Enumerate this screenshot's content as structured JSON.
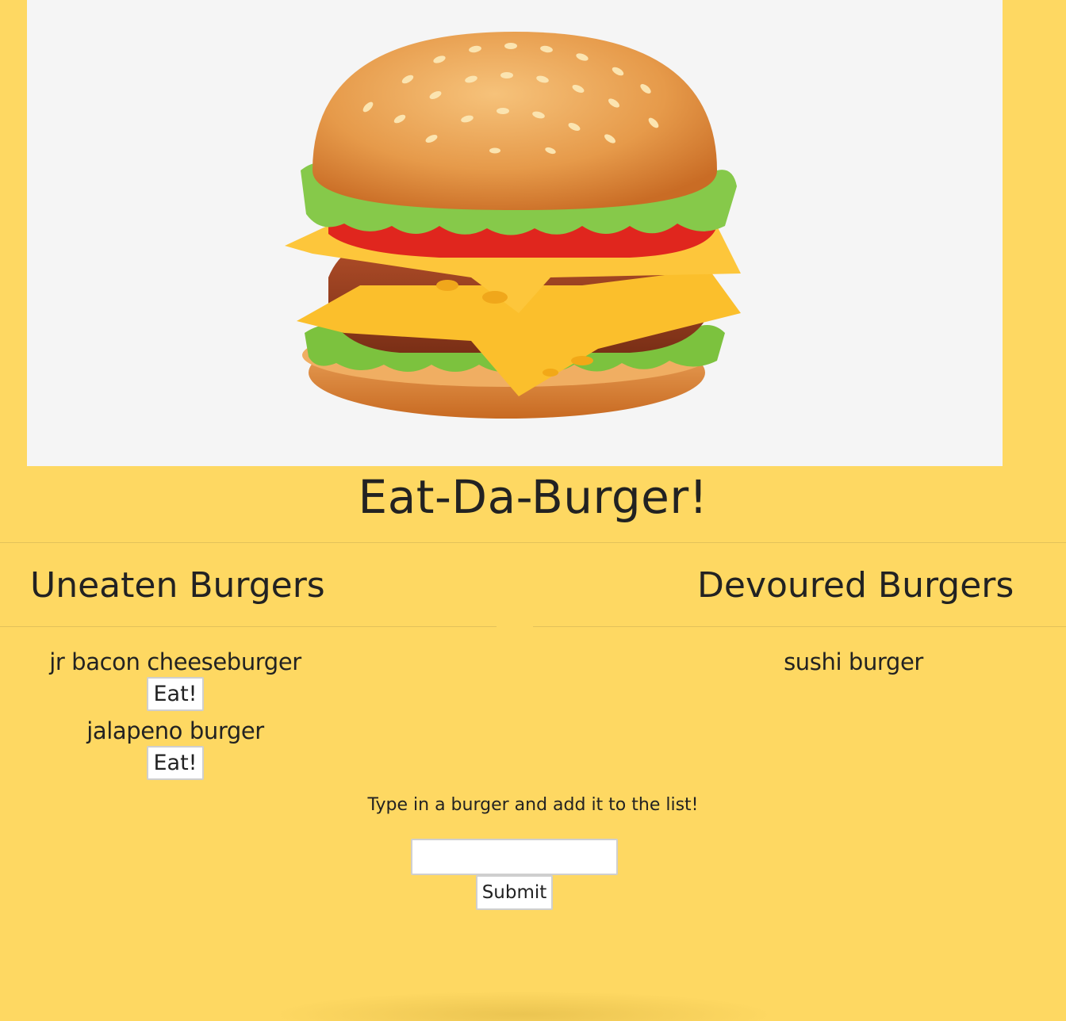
{
  "header": {
    "title": "Eat-Da-Burger!"
  },
  "columns": {
    "uneaten": {
      "heading": "Uneaten Burgers",
      "items": [
        {
          "name": "jr bacon cheeseburger",
          "action_label": "Eat!"
        },
        {
          "name": "jalapeno burger",
          "action_label": "Eat!"
        }
      ]
    },
    "devoured": {
      "heading": "Devoured Burgers",
      "items": [
        {
          "name": "sushi burger"
        }
      ]
    }
  },
  "form": {
    "prompt": "Type in a burger and add it to the list!",
    "input_value": "",
    "input_placeholder": "",
    "submit_label": "Submit"
  },
  "colors": {
    "page_background": "#fed862",
    "hero_background": "#f5f5f5",
    "text": "#222222"
  }
}
